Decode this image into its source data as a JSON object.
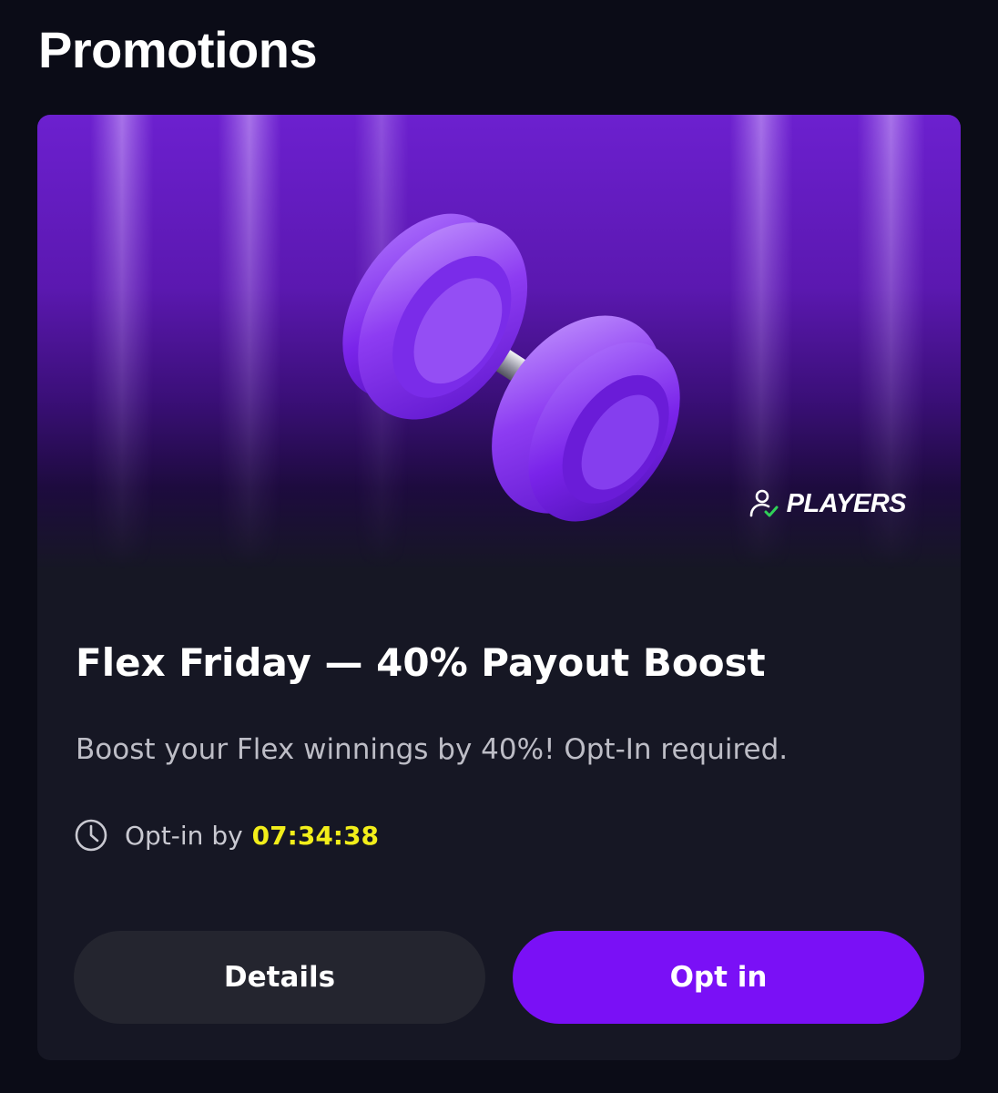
{
  "page": {
    "title": "Promotions"
  },
  "promo": {
    "brand": "PLAYERS",
    "title": "Flex Friday — 40% Payout Boost",
    "description": "Boost your Flex winnings by 40%! Opt-In required.",
    "deadline_label": "Opt-in by",
    "deadline_time": "07:34:38",
    "details_label": "Details",
    "optin_label": "Opt in"
  },
  "icons": {
    "banner_image": "dumbbell-illustration",
    "brand_icon": "person-check-icon",
    "deadline_icon": "clock-icon"
  },
  "colors": {
    "background": "#0b0c17",
    "card": "#161724",
    "accent": "#7a10f6",
    "timer": "#f2ee1a"
  }
}
